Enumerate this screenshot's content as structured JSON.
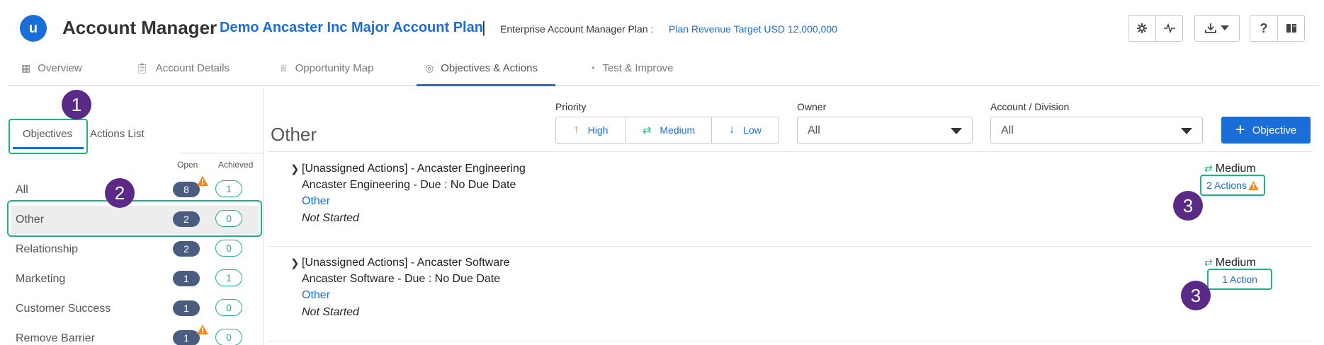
{
  "header": {
    "logo_letter": "u",
    "app_title": "Account Manager",
    "plan_title": "Demo Ancaster Inc Major Account Plan",
    "separator": "|",
    "plan_type": "Enterprise Account Manager Plan :",
    "plan_target": "Plan Revenue Target USD 12,000,000"
  },
  "tabs": [
    {
      "label": "Overview",
      "icon": "grid-icon"
    },
    {
      "label": "Account Details",
      "icon": "clipboard-icon"
    },
    {
      "label": "Opportunity Map",
      "icon": "crown-icon"
    },
    {
      "label": "Objectives & Actions",
      "icon": "target-icon",
      "active": true
    },
    {
      "label": "Test & Improve",
      "icon": "gauge-icon"
    }
  ],
  "left": {
    "subtabs": [
      "Objectives",
      "Actions List"
    ],
    "col_open": "Open",
    "col_achieved": "Achieved",
    "rows": [
      {
        "label": "All",
        "open": "8",
        "achieved": "1",
        "warning": true
      },
      {
        "label": "Other",
        "open": "2",
        "achieved": "0",
        "selected": true
      },
      {
        "label": "Relationship",
        "open": "2",
        "achieved": "0"
      },
      {
        "label": "Marketing",
        "open": "1",
        "achieved": "1"
      },
      {
        "label": "Customer Success",
        "open": "1",
        "achieved": "0"
      },
      {
        "label": "Remove Barrier",
        "open": "1",
        "achieved": "0",
        "warning": true
      }
    ]
  },
  "annotations": [
    "1",
    "2",
    "3",
    "3"
  ],
  "main": {
    "title": "Other",
    "priority_label": "Priority",
    "priority": [
      {
        "label": "High",
        "icon": "arrow-up-icon"
      },
      {
        "label": "Medium",
        "icon": "swap-icon"
      },
      {
        "label": "Low",
        "icon": "arrow-down-icon"
      }
    ],
    "owner_label": "Owner",
    "owner_value": "All",
    "division_label": "Account / Division",
    "division_value": "All",
    "objective_button": "Objective",
    "cards": [
      {
        "title": "[Unassigned Actions] - Ancaster Engineering",
        "subtitle": "Ancaster Engineering - Due : No Due Date",
        "category": "Other",
        "status": "Not Started",
        "priority": "Medium",
        "actions": "2 Actions"
      },
      {
        "title": "[Unassigned Actions] - Ancaster Software",
        "subtitle": "Ancaster Software - Due : No Due Date",
        "category": "Other",
        "status": "Not Started",
        "priority": "Medium",
        "actions": "1 Action"
      }
    ]
  },
  "colors": {
    "accent": "#1a6ed8",
    "highlight": "#1fb28a",
    "annotation": "#5b2a86",
    "badge": "#4a5d80",
    "warning": "#f08a24",
    "medium": "#2fb36f"
  }
}
